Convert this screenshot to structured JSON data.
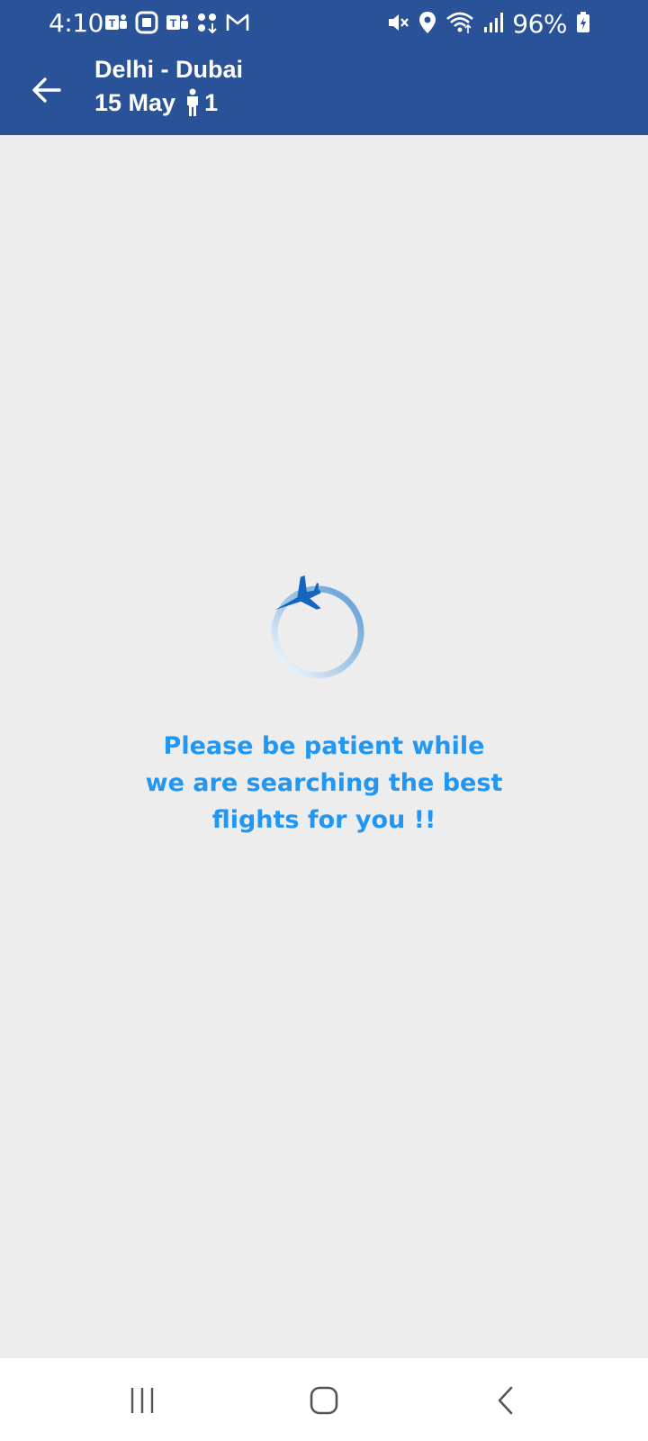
{
  "status_bar": {
    "time": "4:10",
    "battery": "96%",
    "notification_icons": [
      "teams-icon",
      "outlook-icon",
      "teams-icon",
      "app-grid-icon",
      "gmail-icon"
    ],
    "system_icons": [
      "mute-icon",
      "location-icon",
      "wifi-icon",
      "signal-icon",
      "battery-charging-icon"
    ]
  },
  "header": {
    "route": "Delhi - Dubai",
    "date": "15 May",
    "passengers": "1"
  },
  "loading": {
    "message_line1": "Please be patient while",
    "message_line2": "we are searching the best",
    "message_line3": "flights for you !!"
  },
  "nav_bar": {
    "buttons": [
      "recent-apps-icon",
      "home-icon",
      "back-icon"
    ]
  },
  "colors": {
    "header_bg": "#2a5298",
    "background": "#ededed",
    "message_text": "#2196f3",
    "plane": "#1565c0"
  }
}
